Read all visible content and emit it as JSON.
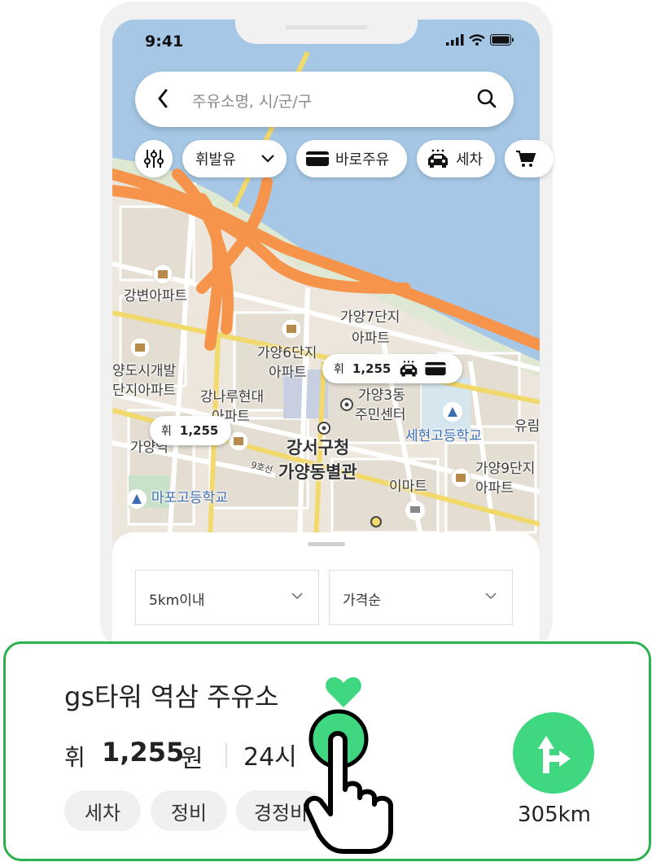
{
  "status_bar": {
    "time": "9:41"
  },
  "search": {
    "placeholder": "주유소명, 시/군/구"
  },
  "filters": {
    "fuel_type": "휘발유",
    "chips": [
      "바로주유",
      "세차"
    ]
  },
  "map": {
    "labels": [
      "강변아파트",
      "가양7단지",
      "아파트",
      "가양6단지",
      "아파트",
      "양도시개발",
      "단지아파트",
      "강나루현대",
      "아파트",
      "가양3동",
      "주민센터",
      "세현고등학교",
      "가양역",
      "강서구청",
      "가양동별관",
      "가양9단지",
      "아파트",
      "이마트",
      "마포고등학교",
      "유림",
      "9호선"
    ],
    "markers": [
      {
        "fuel": "휘",
        "price": "1,255"
      },
      {
        "fuel": "휘",
        "price": "1,255"
      }
    ]
  },
  "sheet": {
    "distance_filter": "5km이내",
    "sort_filter": "가격순"
  },
  "card": {
    "name": "gs타워 역삼 주유소",
    "fuel": "휘",
    "price": "1,255",
    "unit": "원",
    "hours": "24시",
    "tags": [
      "세차",
      "정비",
      "경정비"
    ],
    "distance": "305km"
  },
  "colors": {
    "accent_green": "#3fd881",
    "highlight_border": "#2bb24c",
    "map_water": "#a6c8e6",
    "map_highway": "#f5944a"
  },
  "icons": [
    "back-arrow-icon",
    "search-icon",
    "filter-sliders-icon",
    "chevron-down-icon",
    "card-icon",
    "car-wash-icon",
    "cart-icon",
    "heart-icon",
    "direction-turn-icon",
    "pointing-hand-icon"
  ]
}
